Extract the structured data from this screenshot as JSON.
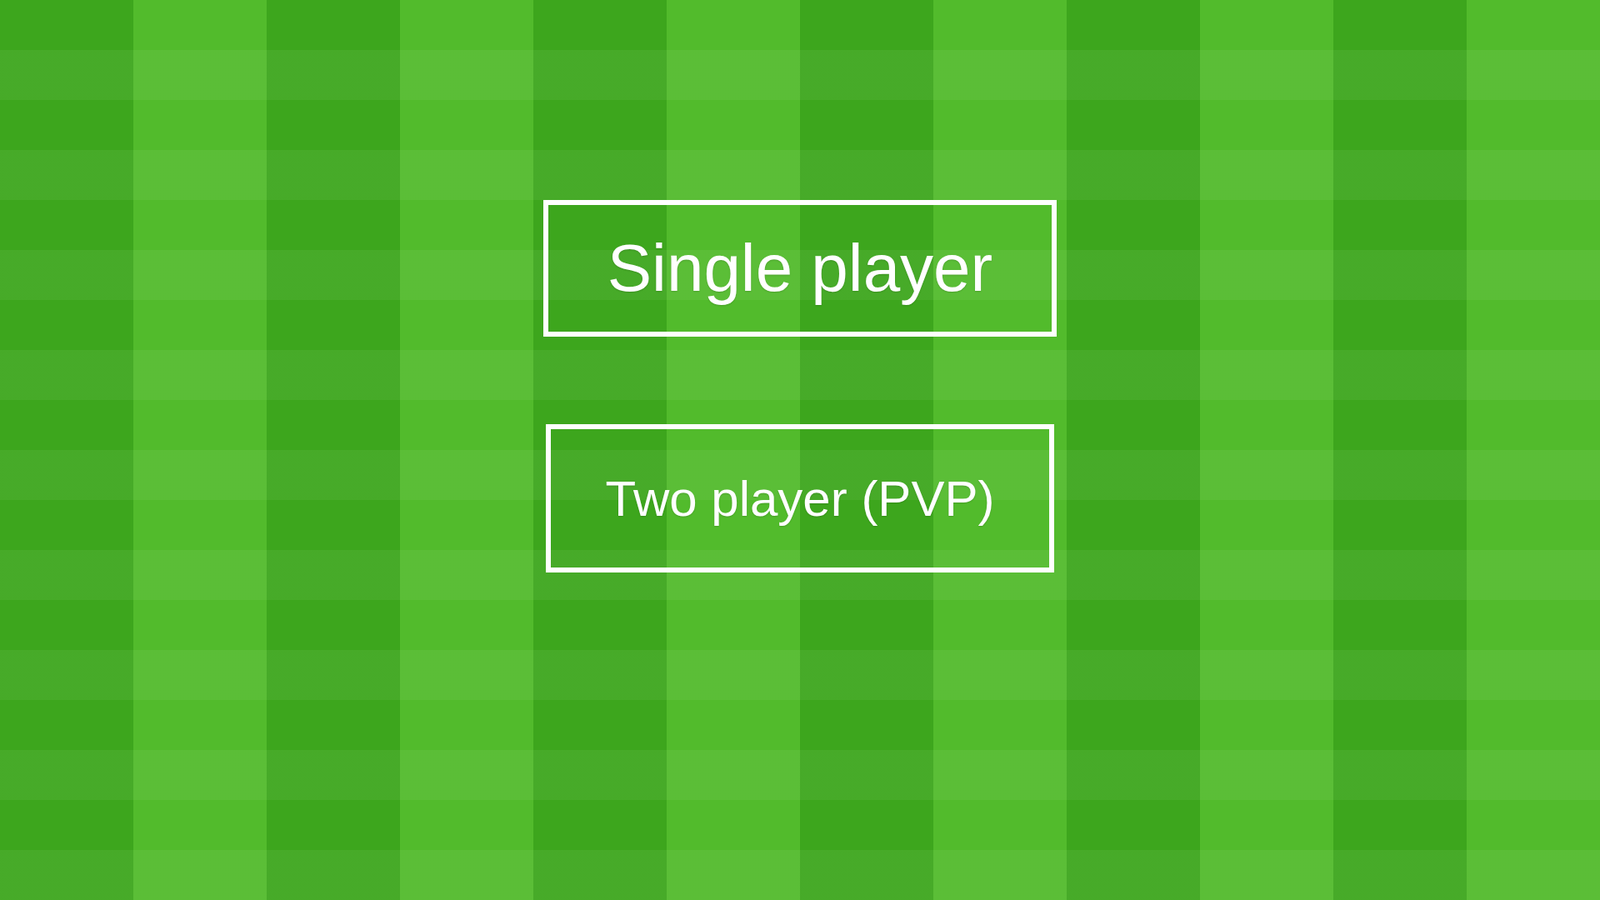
{
  "screen": {
    "name": "main-menu"
  },
  "menu": {
    "buttons": [
      {
        "label": "Single player",
        "kind": "large"
      },
      {
        "label": "Two player (PVP)",
        "kind": "medium"
      }
    ]
  }
}
